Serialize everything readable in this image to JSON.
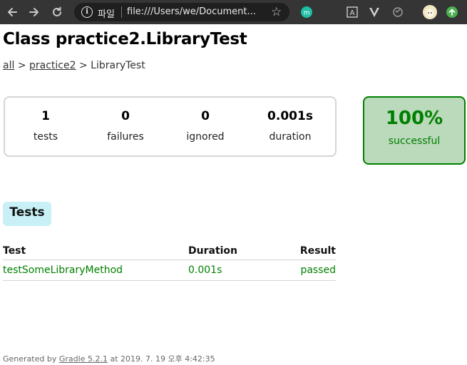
{
  "browser": {
    "scheme_label": "파일",
    "url": "file:///Users/we/Document..."
  },
  "page": {
    "title": "Class practice2.LibraryTest",
    "breadcrumb": {
      "root_link": "all",
      "sep1": ">",
      "package_link": "practice2",
      "sep2": ">",
      "current": "LibraryTest"
    }
  },
  "summary": {
    "counters": [
      {
        "value": "1",
        "label": "tests"
      },
      {
        "value": "0",
        "label": "failures"
      },
      {
        "value": "0",
        "label": "ignored"
      },
      {
        "value": "0.001s",
        "label": "duration"
      }
    ],
    "success_rate": "100%",
    "success_label": "successful"
  },
  "tabs": {
    "active": "Tests"
  },
  "results_table": {
    "headers": [
      "Test",
      "Duration",
      "Result"
    ],
    "rows": [
      {
        "test": "testSomeLibraryMethod",
        "duration": "0.001s",
        "result": "passed"
      }
    ]
  },
  "footer": {
    "prefix": "Generated by",
    "link": "Gradle 5.2.1",
    "suffix": "at 2019. 7. 19 오후 4:42:35"
  },
  "colors": {
    "success": "#008000",
    "success_bg": "#bbd9bb",
    "tab_bg": "#c8f0f6",
    "toolbar_bg": "#353535"
  },
  "icons": [
    "back-icon",
    "forward-icon",
    "reload-icon",
    "info-icon",
    "bookmark-star-icon",
    "extension-m-icon",
    "extension-text-icon",
    "extension-v-icon",
    "extension-sync-icon",
    "profile-avatar-icon",
    "update-arrow-icon"
  ]
}
